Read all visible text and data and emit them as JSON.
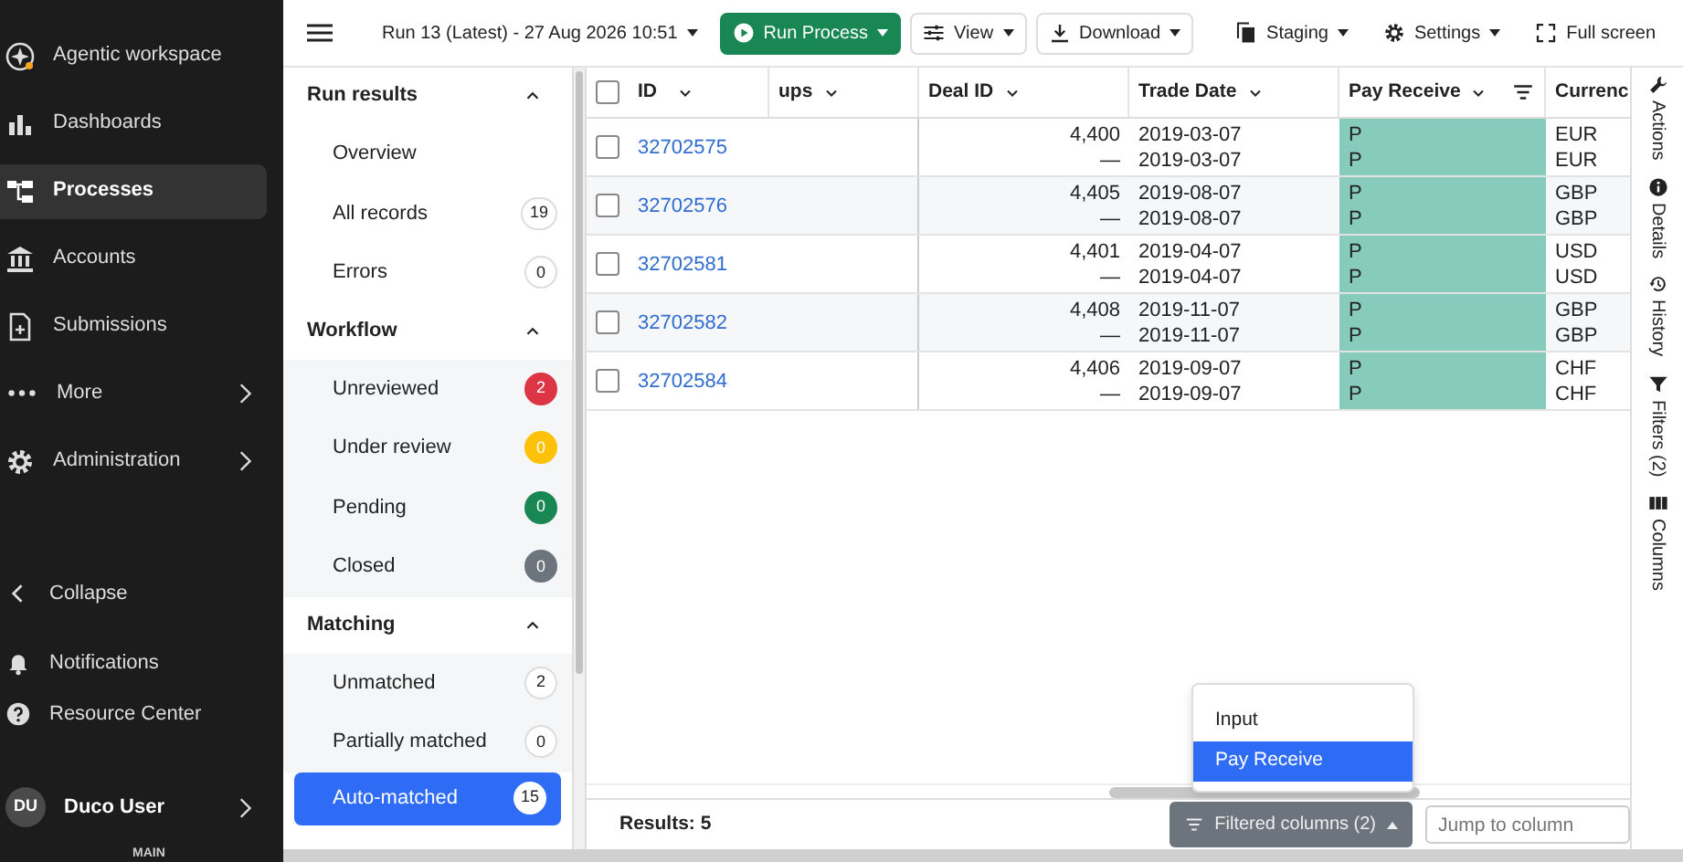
{
  "nav": {
    "items": [
      {
        "label": "Agentic workspace",
        "selected": false
      },
      {
        "label": "Dashboards",
        "selected": false
      },
      {
        "label": "Processes",
        "selected": true
      },
      {
        "label": "Accounts",
        "selected": false
      },
      {
        "label": "Submissions",
        "selected": false
      },
      {
        "label": "More",
        "selected": false,
        "submenu": true
      },
      {
        "label": "Administration",
        "selected": false,
        "submenu": true
      }
    ],
    "bottom": [
      {
        "label": "Collapse"
      },
      {
        "label": "Notifications"
      },
      {
        "label": "Resource Center"
      }
    ],
    "user": {
      "initials": "DU",
      "name": "Duco User"
    },
    "footer": "MAIN"
  },
  "toolbar": {
    "run": "Run 13 (Latest) - 27 Aug 2026 10:51",
    "run_process": "Run Process",
    "view": "View",
    "download": "Download",
    "staging": "Staging",
    "settings": "Settings",
    "full_screen": "Full screen"
  },
  "panel": {
    "sections": [
      {
        "title": "Run results",
        "expanded": true,
        "shaded": false,
        "items": [
          {
            "label": "Overview",
            "selected": false
          },
          {
            "label": "All records",
            "count": "19",
            "selected": false
          },
          {
            "label": "Errors",
            "count": "0",
            "selected": false
          }
        ]
      },
      {
        "title": "Workflow",
        "expanded": true,
        "shaded": true,
        "items": [
          {
            "label": "Unreviewed",
            "count": "2",
            "color": "#dc3545",
            "selected": false
          },
          {
            "label": "Under review",
            "count": "0",
            "color": "#ffc107",
            "selected": false
          },
          {
            "label": "Pending",
            "count": "0",
            "color": "#198754",
            "selected": false
          },
          {
            "label": "Closed",
            "count": "0",
            "color": "#6c757d",
            "selected": false
          }
        ]
      },
      {
        "title": "Matching",
        "expanded": true,
        "shaded": true,
        "items": [
          {
            "label": "Unmatched",
            "count": "2",
            "selected": false
          },
          {
            "label": "Partially matched",
            "count": "0",
            "selected": false
          },
          {
            "label": "Auto-matched",
            "count": "15",
            "selected": true
          }
        ]
      }
    ]
  },
  "table": {
    "columns": [
      {
        "label": "ID"
      },
      {
        "label": "ups"
      },
      {
        "label": "Deal ID"
      },
      {
        "label": "Trade Date"
      },
      {
        "label": "Pay Receive",
        "filtered": true,
        "highlighted": true
      },
      {
        "label": "Currenc"
      }
    ],
    "select_all": {
      "checked": false
    },
    "rows": [
      {
        "id": "32702575",
        "checked": false,
        "deal_id": [
          "4,400",
          "—"
        ],
        "trade_date": [
          "2019-03-07",
          "2019-03-07"
        ],
        "pay_receive": [
          "P",
          "P"
        ],
        "currency": [
          "EUR",
          "EUR"
        ]
      },
      {
        "id": "32702576",
        "checked": false,
        "deal_id": [
          "4,405",
          "—"
        ],
        "trade_date": [
          "2019-08-07",
          "2019-08-07"
        ],
        "pay_receive": [
          "P",
          "P"
        ],
        "currency": [
          "GBP",
          "GBP"
        ]
      },
      {
        "id": "32702581",
        "checked": false,
        "deal_id": [
          "4,401",
          "—"
        ],
        "trade_date": [
          "2019-04-07",
          "2019-04-07"
        ],
        "pay_receive": [
          "P",
          "P"
        ],
        "currency": [
          "USD",
          "USD"
        ]
      },
      {
        "id": "32702582",
        "checked": false,
        "deal_id": [
          "4,408",
          "—"
        ],
        "trade_date": [
          "2019-11-07",
          "2019-11-07"
        ],
        "pay_receive": [
          "P",
          "P"
        ],
        "currency": [
          "GBP",
          "GBP"
        ]
      },
      {
        "id": "32702584",
        "checked": false,
        "deal_id": [
          "4,406",
          "—"
        ],
        "trade_date": [
          "2019-09-07",
          "2019-09-07"
        ],
        "pay_receive": [
          "P",
          "P"
        ],
        "currency": [
          "CHF",
          "CHF"
        ]
      }
    ]
  },
  "footer": {
    "results": "Results: 5",
    "filtered_button": "Filtered columns (2)",
    "jump": {
      "placeholder": "Jump to column"
    },
    "menu": [
      {
        "label": "Input",
        "selected": false
      },
      {
        "label": "Pay Receive",
        "selected": true
      }
    ]
  },
  "rail": [
    {
      "label": "Actions"
    },
    {
      "label": "Details"
    },
    {
      "label": "History"
    },
    {
      "label": "Filters (2)"
    },
    {
      "label": "Columns"
    }
  ]
}
